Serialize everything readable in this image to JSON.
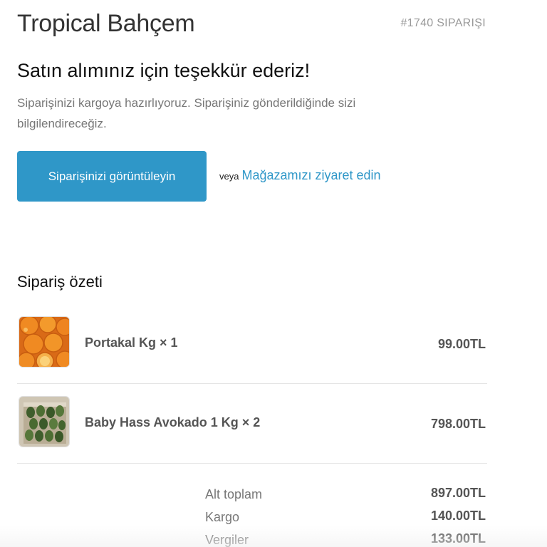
{
  "header": {
    "store_name": "Tropical Bahçem",
    "order_number": "#1740 SIPARIŞI"
  },
  "thanks": {
    "title": "Satın alımınız için teşekkür ederiz!",
    "message": "Siparişinizi kargoya hazırlıyoruz. Siparişiniz gönderildiğinde sizi bilgilendireceğiz."
  },
  "actions": {
    "view_order_label": "Siparişinizi görüntüleyin",
    "or_text": "veya",
    "visit_store_label": "Mağazamızı ziyaret edin"
  },
  "summary": {
    "title": "Sipariş özeti",
    "items": [
      {
        "name": "Portakal Kg × 1",
        "price": "99.00TL",
        "thumb_icon": "orange-icon"
      },
      {
        "name": "Baby Hass Avokado 1 Kg × 2",
        "price": "798.00TL",
        "thumb_icon": "avocado-icon"
      }
    ],
    "totals": [
      {
        "label": "Alt toplam",
        "value": "897.00TL"
      },
      {
        "label": "Kargo",
        "value": "140.00TL"
      },
      {
        "label": "Vergiler",
        "value": "133.00TL"
      }
    ]
  },
  "colors": {
    "accent": "#2f97c8",
    "text": "#333333",
    "muted": "#777777"
  }
}
